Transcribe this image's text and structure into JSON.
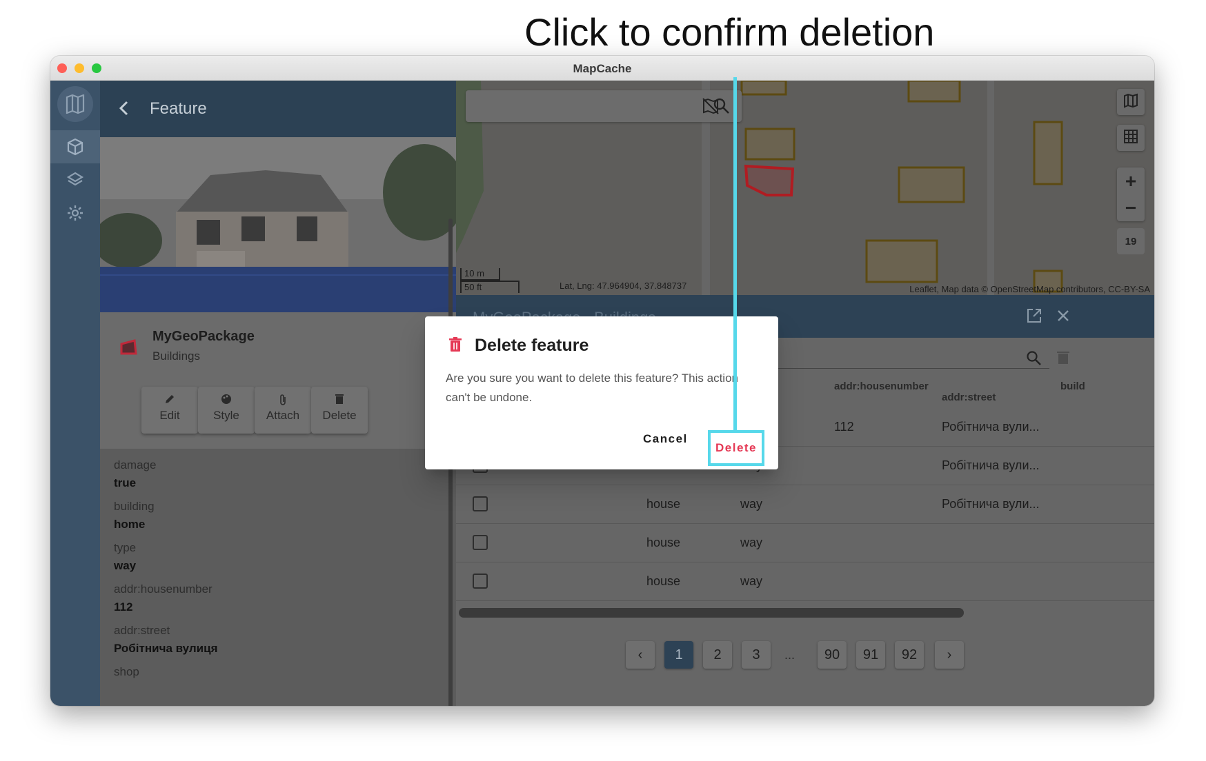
{
  "annotation": "Click to confirm deletion",
  "window": {
    "title": "MapCache"
  },
  "sidebar": {
    "icons": [
      "map-logo-icon",
      "package-icon",
      "layers-icon",
      "settings-icon"
    ]
  },
  "feature_panel": {
    "header_title": "Feature",
    "geopackage_name": "MyGeoPackage",
    "layer_name": "Buildings",
    "actions": {
      "edit": "Edit",
      "style": "Style",
      "attach": "Attach",
      "delete": "Delete"
    },
    "properties": [
      {
        "key": "damage",
        "value": "true"
      },
      {
        "key": "building",
        "value": "home"
      },
      {
        "key": "type",
        "value": "way"
      },
      {
        "key": "addr:housenumber",
        "value": "112"
      },
      {
        "key": "addr:street",
        "value": "Робітнича вулиця"
      },
      {
        "key": "shop",
        "value": ""
      }
    ]
  },
  "map": {
    "scale_metric": "10 m",
    "scale_imperial": "50 ft",
    "latlng": "Lat, Lng: 47.964904, 37.848737",
    "attribution": "Leaflet, Map data © OpenStreetMap contributors, CC-BY-SA",
    "zoom_in": "+",
    "zoom_out": "−",
    "zoom_level": "19"
  },
  "table": {
    "title": "MyGeoPackage - Buildings",
    "columns": [
      "type",
      "addr:housenumber",
      "addr:street",
      "build"
    ],
    "rows": [
      {
        "building": "",
        "type": "way",
        "housenumber": "112",
        "street": "Робітнича вули..."
      },
      {
        "building": "house",
        "type": "way",
        "housenumber": "",
        "street": "Робітнича вули..."
      },
      {
        "building": "house",
        "type": "way",
        "housenumber": "",
        "street": "Робітнича вули..."
      },
      {
        "building": "house",
        "type": "way",
        "housenumber": "",
        "street": ""
      },
      {
        "building": "house",
        "type": "way",
        "housenumber": "",
        "street": ""
      }
    ],
    "pagination": {
      "prev": "‹",
      "next": "›",
      "pages": [
        "1",
        "2",
        "3"
      ],
      "ellipsis": "...",
      "last_pages": [
        "90",
        "91",
        "92"
      ],
      "current": "1"
    }
  },
  "dialog": {
    "title": "Delete feature",
    "message": "Are you sure you want to delete this feature? This action can't be undone.",
    "cancel_label": "Cancel",
    "delete_label": "Delete"
  },
  "colors": {
    "accent": "#56d8ea",
    "danger": "#e53955",
    "header": "#2c4154"
  }
}
